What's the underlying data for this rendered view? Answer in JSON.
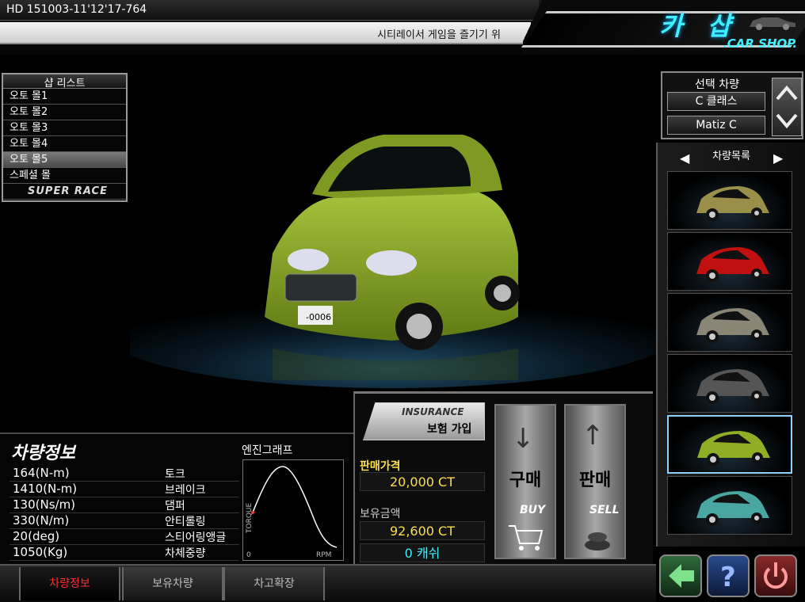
{
  "session_id": "HD 151003-11'12'17-764",
  "ticker": "시티레이서 게임을 즐기기 위",
  "shop": {
    "title": "카 샵",
    "subtitle": ".CAR SHOP."
  },
  "shop_list": {
    "header": "샵 리스트",
    "items": [
      "오토 몰1",
      "오토 몰2",
      "오토 몰3",
      "오토 몰4",
      "오토 몰5",
      "스페셜 몰",
      "SUPER RACE"
    ],
    "selected_index": 4
  },
  "selected_car": {
    "header": "선택 차량",
    "class_name": "C 클래스",
    "model": "Matiz C"
  },
  "car_list": {
    "header": "차량목록",
    "thumbs": [
      {
        "color": "#9a8f4a"
      },
      {
        "color": "#c01010"
      },
      {
        "color": "#8a8676"
      },
      {
        "color": "#555555"
      },
      {
        "color": "#8fae26"
      },
      {
        "color": "#4aa6a0"
      }
    ],
    "selected_index": 4
  },
  "plate": "-0006",
  "info": {
    "title": "차량정보",
    "specs": [
      {
        "value": "164(N-m)",
        "label": "토크"
      },
      {
        "value": "1410(N-m)",
        "label": "브레이크"
      },
      {
        "value": "130(Ns/m)",
        "label": "댐퍼"
      },
      {
        "value": "330(N/m)",
        "label": "안티롤링"
      },
      {
        "value": "20(deg)",
        "label": "스티어링앵글"
      },
      {
        "value": "1050(Kg)",
        "label": "차체중량"
      }
    ]
  },
  "engine_graph": {
    "title": "엔진그래프",
    "ylabel": "TORQUE",
    "xlabel": "RPM",
    "origin": "0"
  },
  "insurance": {
    "en": "INSURANCE",
    "kr": "보험 가입"
  },
  "price": {
    "sale_label": "판매가격",
    "sale_value": "20,000 CT",
    "owned_label": "보유금액",
    "owned_value": "92,600 CT",
    "cash_value": "0 캐쉬"
  },
  "buy": {
    "kr": "구매",
    "en": "BUY"
  },
  "sell": {
    "kr": "판매",
    "en": "SELL"
  },
  "tabs": [
    "차량정보",
    "보유차량",
    "차고확장"
  ],
  "colors": {
    "accent": "#3ff0ff",
    "price": "#ffdf4a",
    "car": "#8fae26"
  }
}
